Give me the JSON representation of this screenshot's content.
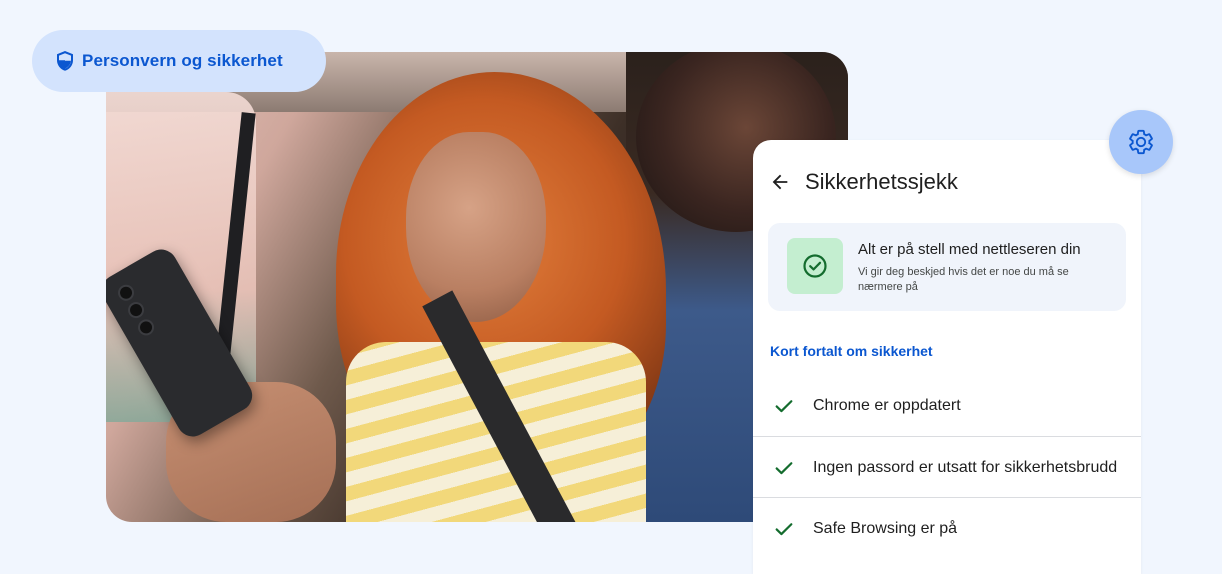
{
  "chip": {
    "label": "Personvern og sikkerhet",
    "icon": "shield-icon"
  },
  "panel": {
    "title": "Sikkerhetssjekk",
    "back_icon": "arrow-back-icon",
    "status": {
      "title": "Alt er på stell med nettleseren din",
      "description": "Vi gir deg beskjed hvis det er noe du må se nærmere på",
      "icon": "check-circle-icon"
    },
    "section_heading": "Kort fortalt om sikkerhet",
    "items": [
      {
        "label": "Chrome er oppdatert",
        "icon": "check-icon"
      },
      {
        "label": "Ingen passord er utsatt for sikkerhetsbrudd",
        "icon": "check-icon"
      },
      {
        "label": "Safe Browsing er på",
        "icon": "check-icon"
      }
    ]
  },
  "gear_button": {
    "icon": "gear-icon"
  },
  "colors": {
    "background": "#f1f6fe",
    "accent_blue": "#0b57d0",
    "chip_bg": "#d3e3fd",
    "gear_bg": "#a8c7fa",
    "success_green": "#146c2e",
    "success_bg": "#c4eed0"
  }
}
